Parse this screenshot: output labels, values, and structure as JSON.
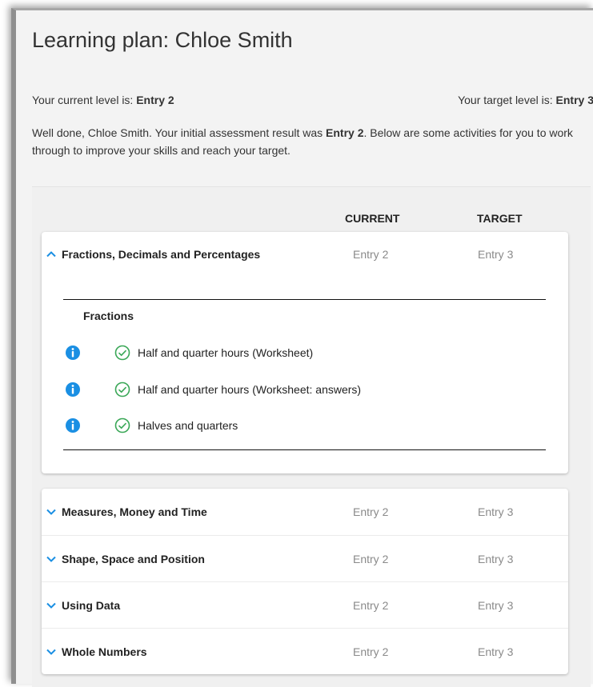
{
  "page": {
    "title": "Learning plan: Chloe Smith",
    "current_level_prefix": "Your current level is: ",
    "current_level": "Entry 2",
    "target_level_prefix": "Your target level is: ",
    "target_level": "Entry 3",
    "intro_part1": "Well done, Chloe Smith. Your initial assessment result was ",
    "intro_bold": "Entry 2",
    "intro_part2": ". Below are some activities for you to work through to improve your skills and reach your target."
  },
  "table": {
    "col_current": "CURRENT",
    "col_target": "TARGET"
  },
  "expanded_topic": {
    "title": "Fractions, Decimals and Percentages",
    "current": "Entry 2",
    "target": "Entry 3",
    "section": "Fractions",
    "activities": [
      "Half and quarter hours (Worksheet)",
      "Half and quarter hours (Worksheet: answers)",
      "Halves and quarters"
    ]
  },
  "collapsed_topics": [
    {
      "title": "Measures, Money and Time",
      "current": "Entry 2",
      "target": "Entry 3"
    },
    {
      "title": "Shape, Space and Position",
      "current": "Entry 2",
      "target": "Entry 3"
    },
    {
      "title": "Using Data",
      "current": "Entry 2",
      "target": "Entry 3"
    },
    {
      "title": "Whole Numbers",
      "current": "Entry 2",
      "target": "Entry 3"
    }
  ],
  "colors": {
    "accent": "#1a8fe3",
    "check": "#3aa757"
  },
  "icons": {
    "expanded_chevron": "chevron-up-icon",
    "collapsed_chevron": "chevron-down-icon",
    "info": "info-icon",
    "completed": "check-circle-icon"
  }
}
